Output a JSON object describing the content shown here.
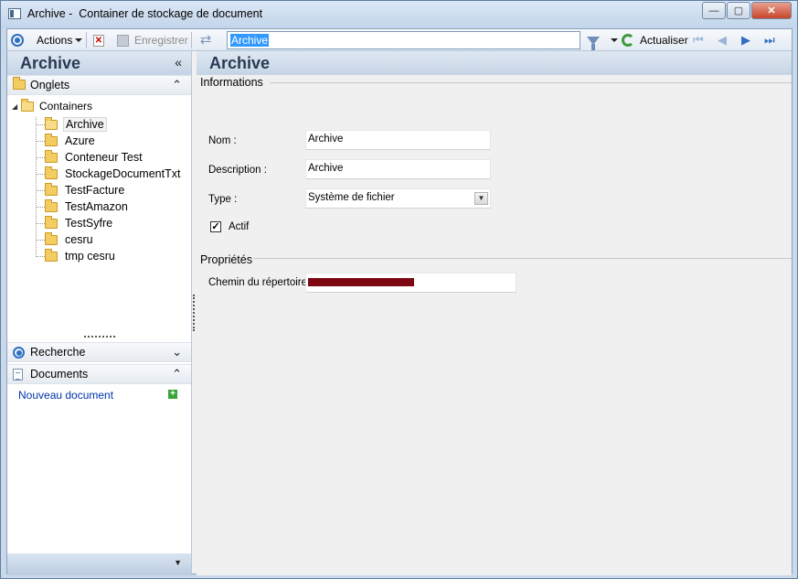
{
  "window": {
    "title": "Archive -  Container de stockage de document",
    "minimize_symbol": "—",
    "maximize_symbol": "▢",
    "close_symbol": "✕"
  },
  "toolbar": {
    "actions_label": "Actions",
    "save_label": "Enregistrer",
    "search_value": "Archive",
    "refresh_label": "Actualiser",
    "nav_first": "⏮",
    "nav_prev": "◀",
    "nav_next": "▶",
    "nav_last": "⏭"
  },
  "left_panel": {
    "title": "Archive",
    "collapse_symbol": "«",
    "groups": {
      "onglets": {
        "label": "Onglets",
        "chevron": "⌃"
      },
      "recherche": {
        "label": "Recherche",
        "chevron": "⌄"
      },
      "documents": {
        "label": "Documents",
        "chevron": "⌃"
      }
    },
    "tree": {
      "root": "Containers",
      "items": [
        "Archive",
        "Azure",
        "Conteneur Test",
        "StockageDocumentTxt",
        "TestFacture",
        "TestAmazon",
        "TestSyfre",
        "cesru",
        "tmp cesru"
      ],
      "selected_index": 0
    },
    "new_document_link": "Nouveau document",
    "footer_chevron": "▼"
  },
  "right_panel": {
    "title": "Archive",
    "informations_section": "Informations",
    "nom_label": "Nom :",
    "nom_value": "Archive",
    "description_label": "Description :",
    "description_value": "Archive",
    "type_label": "Type :",
    "type_value": "Système de fichier",
    "actif_label": "Actif",
    "actif_checked": true,
    "proprietes_section": "Propriétés",
    "chemin_label": "Chemin du répertoire :"
  },
  "colors": {
    "accent": "#2f6fc1",
    "header_text": "#2a3a52",
    "link": "#0033aa",
    "redaction": "#7d0812"
  }
}
